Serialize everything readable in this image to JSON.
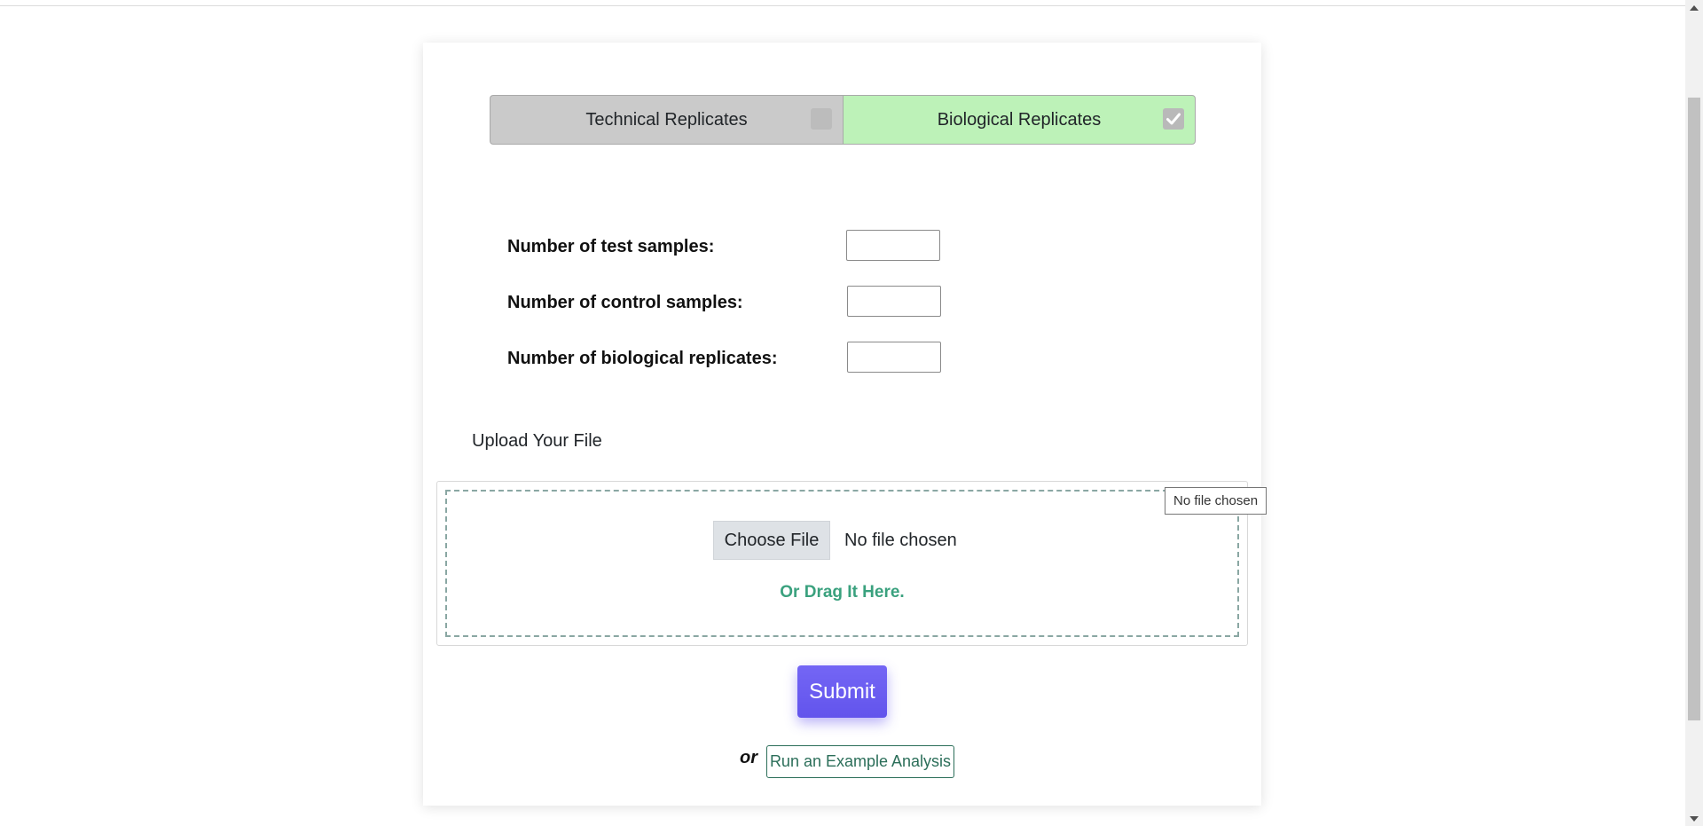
{
  "replicate_toggle": {
    "technical_label": "Technical Replicates",
    "technical_checked": false,
    "biological_label": "Biological Replicates",
    "biological_checked": true
  },
  "form": {
    "test_samples_label": "Number of test samples:",
    "test_samples_value": "",
    "control_samples_label": "Number of control samples:",
    "control_samples_value": "",
    "biological_replicates_label": "Number of biological replicates:",
    "biological_replicates_value": ""
  },
  "upload": {
    "title": "Upload Your File",
    "choose_button": "Choose File",
    "file_status": "No file chosen",
    "drag_text": "Or Drag It Here.",
    "tooltip": "No file chosen"
  },
  "actions": {
    "submit_label": "Submit",
    "or_text": "or",
    "example_label": "Run an Example Analysis"
  },
  "colors": {
    "accent": "#6a5cf0",
    "selected_toggle": "#bdf2b8",
    "unselected_toggle": "#cacaca",
    "drag_text": "#3aa17e",
    "example_button": "#2b6e59"
  }
}
